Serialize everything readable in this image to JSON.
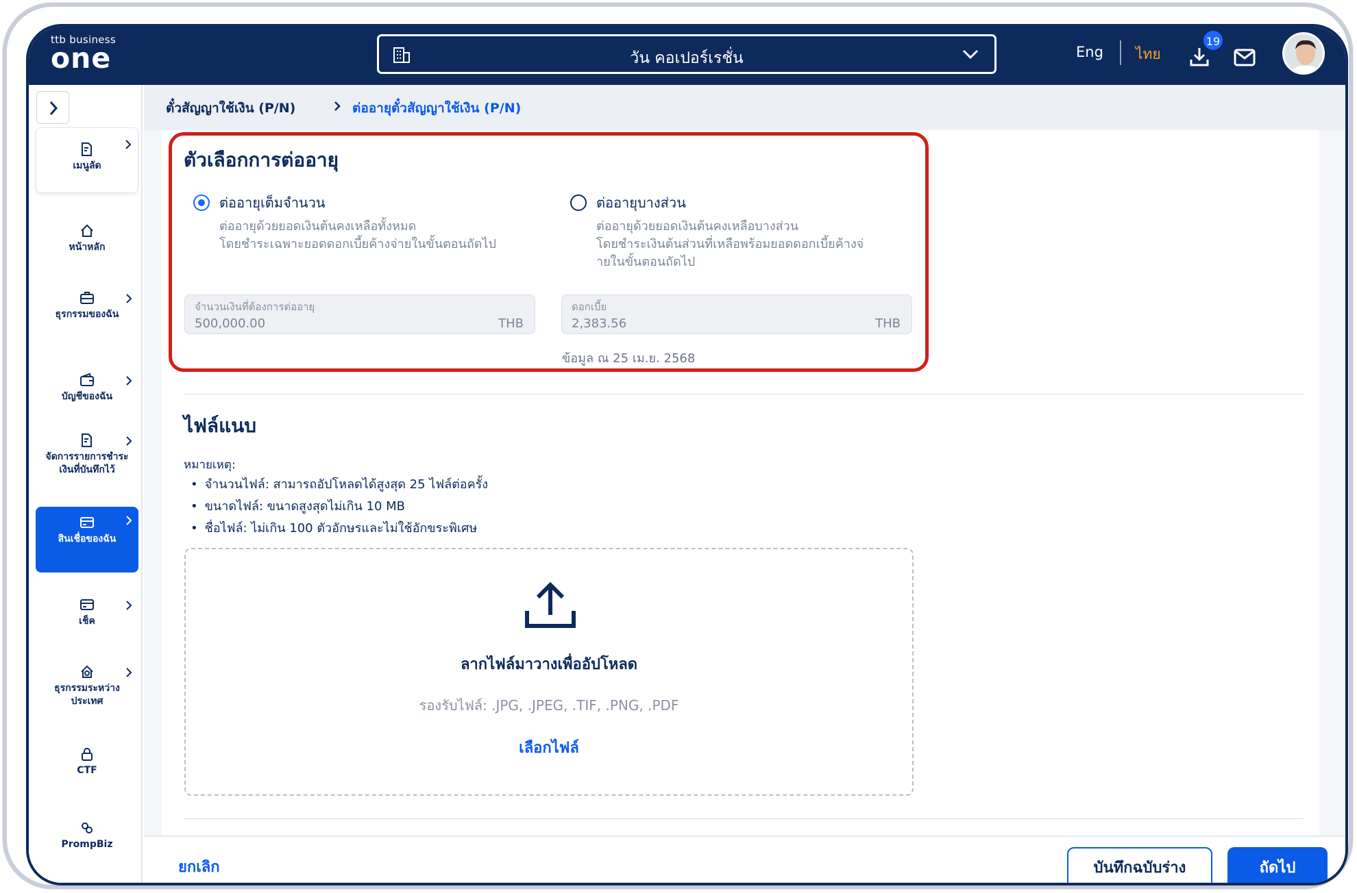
{
  "header": {
    "logo_top": "ttb business",
    "logo_main": "one",
    "company": "วัน คอเปอร์เรชั่น",
    "lang_en": "Eng",
    "lang_th": "ไทย",
    "download_badge": "19"
  },
  "sidebar": {
    "items": [
      {
        "label": "เมนูลัด",
        "icon": "document-icon"
      },
      {
        "label": "หน้าหลัก",
        "icon": "home-icon"
      },
      {
        "label": "ธุรกรรมของฉัน",
        "icon": "briefcase-icon"
      },
      {
        "label": "บัญชีของฉัน",
        "icon": "wallet-icon"
      },
      {
        "label": "จัดการรายการชำระเงินที่บันทึกไว้",
        "icon": "document-icon"
      },
      {
        "label": "สินเชื่อของฉัน",
        "icon": "card-icon"
      },
      {
        "label": "เช็ค",
        "icon": "cheque-icon"
      },
      {
        "label": "ธุรกรรมระหว่างประเทศ",
        "icon": "globe-home-icon"
      },
      {
        "label": "CTF",
        "icon": "lock-icon"
      },
      {
        "label": "PrompBiz",
        "icon": "link-icon"
      }
    ]
  },
  "breadcrumb": {
    "item1": "ตั๋วสัญญาใช้เงิน (P/N)",
    "item2": "ต่ออายุตั๋วสัญญาใช้เงิน (P/N)"
  },
  "renewal": {
    "title": "ตัวเลือกการต่ออายุ",
    "option_full": {
      "label": "ต่ออายุเต็มจำนวน",
      "desc1": "ต่ออายุด้วยยอดเงินต้นคงเหลือทั้งหมด",
      "desc2": "โดยชำระเฉพาะยอดดอกเบี้ยค้างจ่ายในขั้นตอนถัดไป",
      "selected": true
    },
    "option_partial": {
      "label": "ต่ออายุบางส่วน",
      "desc1": "ต่ออายุด้วยยอดเงินต้นคงเหลือบางส่วน",
      "desc2": "โดยชำระเงินต้นส่วนที่เหลือพร้อมยอดดอกเบี้ยค้างจ่",
      "desc3": "ายในขั้นตอนถัดไป",
      "selected": false
    },
    "amount": {
      "label": "จำนวนเงินที่ต้องการต่ออายุ",
      "value": "500,000.00",
      "currency": "THB"
    },
    "interest": {
      "label": "ดอกเบี้ย",
      "value": "2,383.56",
      "currency": "THB"
    },
    "as_of": "ข้อมูล ณ 25 เม.ย. 2568"
  },
  "attachments": {
    "title": "ไฟล์แนบ",
    "note_heading": "หมายเหตุ:",
    "notes": [
      "จำนวนไฟล์: สามารถอัปโหลดได้สูงสุด 25 ไฟล์ต่อครั้ง",
      "ขนาดไฟล์: ขนาดสูงสุดไม่เกิน 10 MB",
      "ชื่อไฟล์: ไม่เกิน 100 ตัวอักษรและไม่ใช้อักขระพิเศษ"
    ],
    "drop_title": "ลากไฟล์มาวางเพื่ออัปโหลด",
    "accepted_types": "รองรับไฟล์: .JPG, .JPEG, .TIF, .PNG, .PDF",
    "choose_file": "เลือกไฟล์"
  },
  "footer": {
    "cancel": "ยกเลิก",
    "save_draft": "บันทึกฉบับร่าง",
    "next": "ถัดไป"
  },
  "colors": {
    "navy": "#0d2a5c",
    "primary": "#0a5be6",
    "accent_orange": "#f5a623",
    "highlight_red": "#d0201a"
  }
}
